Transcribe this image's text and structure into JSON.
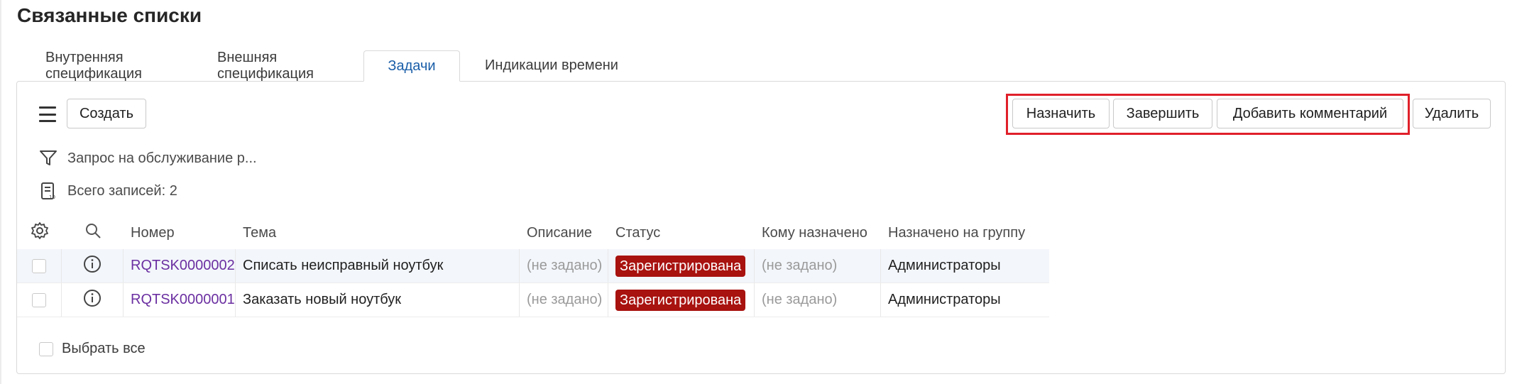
{
  "page": {
    "title": "Связанные списки"
  },
  "tabs": [
    {
      "label": "Внутренняя спецификация",
      "active": false
    },
    {
      "label": "Внешняя спецификация",
      "active": false
    },
    {
      "label": "Задачи",
      "active": true
    },
    {
      "label": "Индикации времени",
      "active": false
    }
  ],
  "toolbar": {
    "menu_icon": "hamburger-icon",
    "create_label": "Создать",
    "assign_label": "Назначить",
    "complete_label": "Завершить",
    "add_comment_label": "Добавить комментарий",
    "delete_label": "Удалить"
  },
  "filter": {
    "icon": "filter-icon",
    "text": "Запрос на обслуживание р..."
  },
  "records": {
    "icon": "document-list-icon",
    "text": "Всего записей: 2"
  },
  "table": {
    "settings_icon": "gear-icon",
    "search_icon": "search-icon",
    "columns": [
      "Номер",
      "Тема",
      "Описание",
      "Статус",
      "Кому назначено",
      "Назначено на группу"
    ],
    "rows": [
      {
        "number": "RQTSK0000002",
        "subject": "Списать неисправный ноутбук",
        "description": "(не задано)",
        "status": "Зарегистрирована",
        "assigned_to": "(не задано)",
        "group": "Администраторы"
      },
      {
        "number": "RQTSK0000001",
        "subject": "Заказать новый ноутбук",
        "description": "(не задано)",
        "status": "Зарегистрирована",
        "assigned_to": "(не задано)",
        "group": "Администраторы"
      }
    ]
  },
  "footer": {
    "select_all_label": "Выбрать все"
  },
  "colors": {
    "status_badge": "#a8120f",
    "link": "#6b2fa1",
    "active_tab": "#1a5ea8",
    "highlight": "#e0202a"
  }
}
